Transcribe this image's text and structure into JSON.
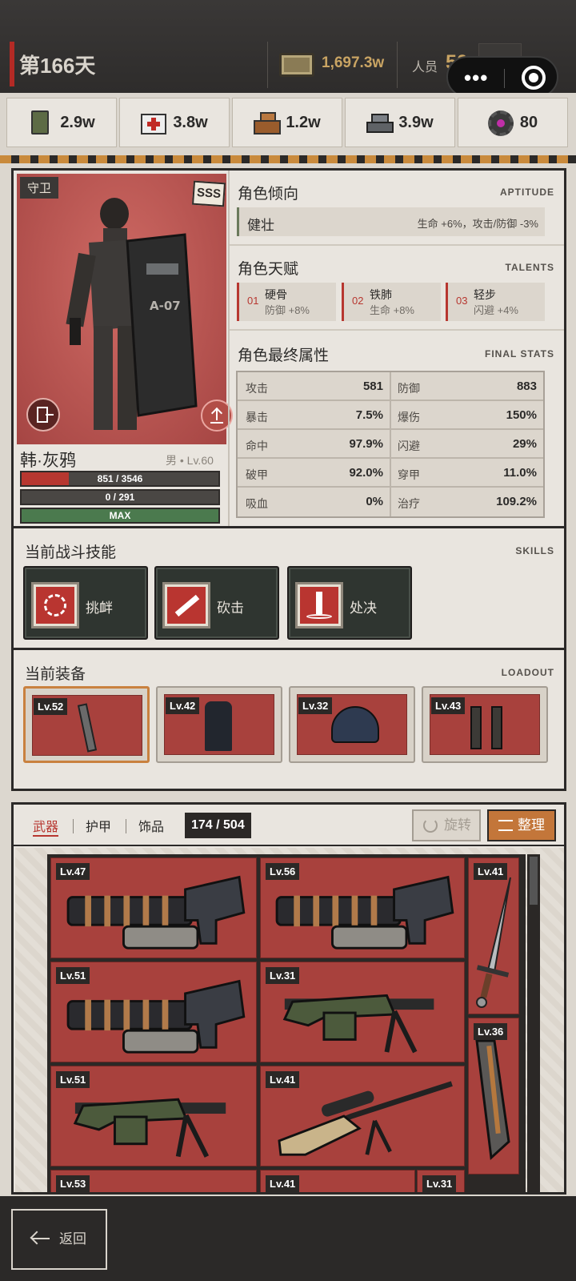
{
  "header": {
    "day": "第166天",
    "money": "1,697.3w",
    "staff_label": "人员",
    "staff": "50"
  },
  "resources": [
    {
      "icon": "food-can-icon",
      "value": "2.9w"
    },
    {
      "icon": "medkit-icon",
      "value": "3.8w"
    },
    {
      "icon": "wood-icon",
      "value": "1.2w"
    },
    {
      "icon": "steel-icon",
      "value": "3.9w"
    },
    {
      "icon": "gear-core-icon",
      "value": "80"
    }
  ],
  "character": {
    "role": "守卫",
    "rank": "SSS",
    "name": "韩·灰鸦",
    "meta": "男 • Lv.60",
    "hp_text": "851 / 3546",
    "hp_ratio": 0.24,
    "xp_text": "0 / 291",
    "level_text": "MAX"
  },
  "aptitude": {
    "title": "角色倾向",
    "title_en": "APTITUDE",
    "name": "健壮",
    "desc": "生命 +6%，攻击/防御 -3%"
  },
  "talents": {
    "title": "角色天赋",
    "title_en": "TALENTS",
    "items": [
      {
        "num": "01",
        "name": "硬骨",
        "desc": "防御 +8%"
      },
      {
        "num": "02",
        "name": "铁肺",
        "desc": "生命 +8%"
      },
      {
        "num": "03",
        "name": "轻步",
        "desc": "闪避 +4%"
      }
    ]
  },
  "final_stats": {
    "title": "角色最终属性",
    "title_en": "FINAL STATS",
    "rows": [
      {
        "k1": "攻击",
        "v1": "581",
        "k2": "防御",
        "v2": "883"
      },
      {
        "k1": "暴击",
        "v1": "7.5%",
        "k2": "爆伤",
        "v2": "150%"
      },
      {
        "k1": "命中",
        "v1": "97.9%",
        "k2": "闪避",
        "v2": "29%"
      },
      {
        "k1": "破甲",
        "v1": "92.0%",
        "k2": "穿甲",
        "v2": "11.0%"
      },
      {
        "k1": "吸血",
        "v1": "0%",
        "k2": "治疗",
        "v2": "109.2%"
      }
    ]
  },
  "skills": {
    "title": "当前战斗技能",
    "title_en": "SKILLS",
    "items": [
      "挑衅",
      "砍击",
      "处决"
    ]
  },
  "loadout": {
    "title": "当前装备",
    "title_en": "LOADOUT",
    "items": [
      "Lv.52",
      "Lv.42",
      "Lv.32",
      "Lv.43"
    ]
  },
  "inventory": {
    "tabs": [
      "武器",
      "护甲",
      "饰品"
    ],
    "capacity": "174 / 504",
    "rotate_label": "旋转",
    "sort_label": "整理",
    "items": [
      "Lv.47",
      "Lv.56",
      "Lv.41",
      "Lv.51",
      "Lv.31",
      "Lv.36",
      "Lv.51",
      "Lv.41",
      "Lv.53",
      "Lv.41",
      "Lv.31"
    ]
  },
  "footer": {
    "back_label": "返回"
  }
}
